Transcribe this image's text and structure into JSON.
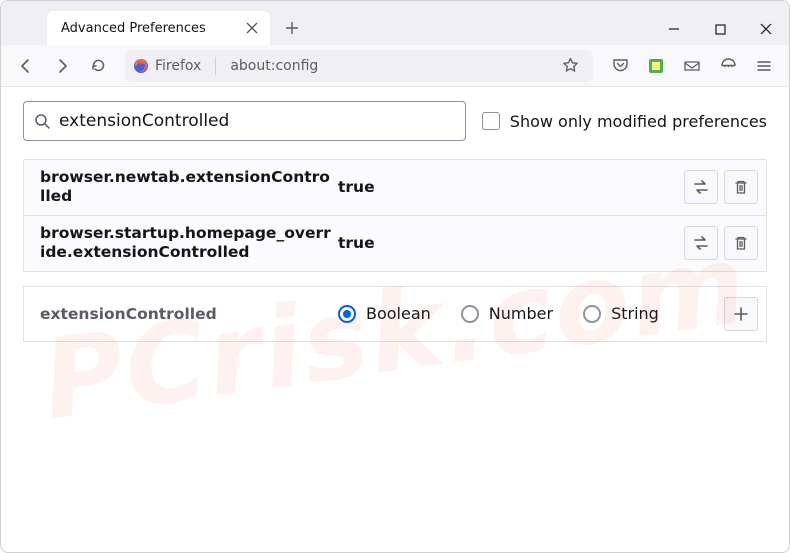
{
  "tab": {
    "title": "Advanced Preferences"
  },
  "urlbar": {
    "identity_label": "Firefox",
    "url": "about:config"
  },
  "content": {
    "search_value": "extensionControlled",
    "show_only_modified_label": "Show only modified preferences",
    "results": [
      {
        "name": "browser.newtab.extensionControlled",
        "value": "true"
      },
      {
        "name": "browser.startup.homepage_override.extensionControlled",
        "value": "true"
      }
    ],
    "new_pref": {
      "name": "extensionControlled",
      "types": {
        "boolean": "Boolean",
        "number": "Number",
        "string": "String"
      },
      "selected": "boolean"
    }
  },
  "watermark": "PCrisk.com"
}
